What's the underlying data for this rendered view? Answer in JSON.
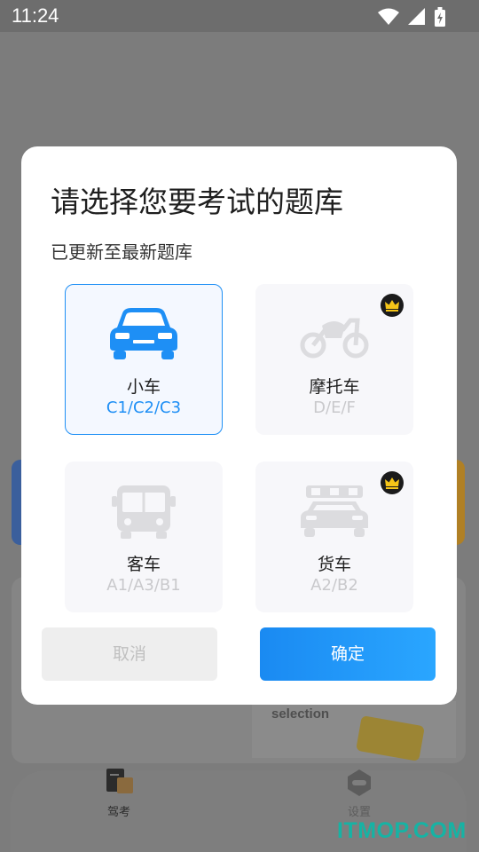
{
  "status_bar": {
    "time": "11:24"
  },
  "background": {
    "selection_text": "selection"
  },
  "bottom_nav": {
    "items": [
      {
        "label": "驾考",
        "icon": "book-icon"
      },
      {
        "label": "设置",
        "icon": "settings-icon"
      }
    ]
  },
  "dialog": {
    "title": "请选择您要考试的题库",
    "subtitle": "已更新至最新题库",
    "options": [
      {
        "name": "小车",
        "codes": "C1/C2/C3",
        "icon": "car-icon",
        "selected": true,
        "vip": false
      },
      {
        "name": "摩托车",
        "codes": "D/E/F",
        "icon": "motorcycle-icon",
        "selected": false,
        "vip": true
      },
      {
        "name": "客车",
        "codes": "A1/A3/B1",
        "icon": "bus-icon",
        "selected": false,
        "vip": false
      },
      {
        "name": "货车",
        "codes": "A2/B2",
        "icon": "truck-icon",
        "selected": false,
        "vip": true
      }
    ],
    "cancel_label": "取消",
    "confirm_label": "确定"
  },
  "watermark": "ITMOP.COM",
  "colors": {
    "accent": "#1e8ff5",
    "crown": "#f5c518",
    "watermark": "#16b3a4"
  }
}
